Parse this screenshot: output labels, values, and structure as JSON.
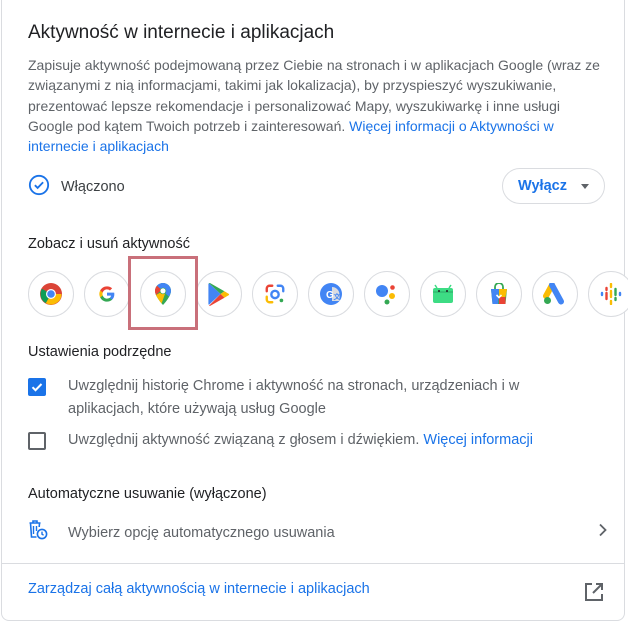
{
  "card": {
    "title": "Aktywność w internecie i aplikacjach",
    "description": "Zapisuje aktywność podejmowaną przez Ciebie na stronach i w aplikacjach Google (wraz ze związanymi z nią informacjami, takimi jak lokalizacja), by przyspieszyć wyszukiwanie, prezentować lepsze rekomendacje i personalizować Mapy, wyszukiwarkę i inne usługi Google pod kątem Twoich potrzeb i zainteresowań.",
    "description_link": "Więcej informacji o Aktywności w internecie i aplikacjach"
  },
  "status": {
    "label": "Włączono",
    "icon": "check-circle-icon",
    "toggle_button": "Wyłącz"
  },
  "view_section": {
    "heading": "Zobacz i usuń aktywność",
    "apps": [
      "chrome-icon",
      "google-icon",
      "maps-icon",
      "play-icon",
      "lens-icon",
      "translate-icon",
      "assistant-icon",
      "android-icon",
      "shopping-icon",
      "ads-icon",
      "podcasts-icon"
    ],
    "selected_app": "maps-icon"
  },
  "subsettings": {
    "heading": "Ustawienia podrzędne",
    "items": [
      {
        "text": "Uwzględnij historię Chrome i aktywność na stronach, urządzeniach i w aplikacjach, które używają usług Google",
        "checked": true,
        "link": ""
      },
      {
        "text": "Uwzględnij aktywność związaną z głosem i dźwiękiem.",
        "checked": false,
        "link": "Więcej informacji"
      }
    ]
  },
  "auto_delete": {
    "heading": "Automatyczne usuwanie (wyłączone)",
    "option_label": "Wybierz opcję automatycznego usuwania"
  },
  "footer": {
    "manage_link": "Zarządzaj całą aktywnością w internecie i aplikacjach"
  },
  "colors": {
    "accent": "#1a73e8",
    "highlight": "#c9707a"
  }
}
